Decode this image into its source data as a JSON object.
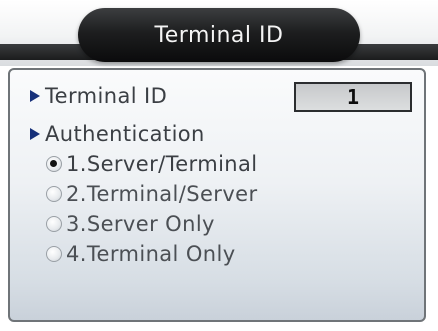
{
  "window": {
    "title": "Terminal ID"
  },
  "terminal_id": {
    "label": "Terminal ID",
    "value": "1"
  },
  "authentication": {
    "label": "Authentication",
    "selected_index": 0,
    "options": [
      {
        "label": "1.Server/Terminal"
      },
      {
        "label": "2.Terminal/Server"
      },
      {
        "label": "3.Server Only"
      },
      {
        "label": "4.Terminal Only"
      }
    ]
  },
  "colors": {
    "accent": "#16307a",
    "title_bar": "#1d1e1f",
    "panel_border": "#6f7478"
  }
}
